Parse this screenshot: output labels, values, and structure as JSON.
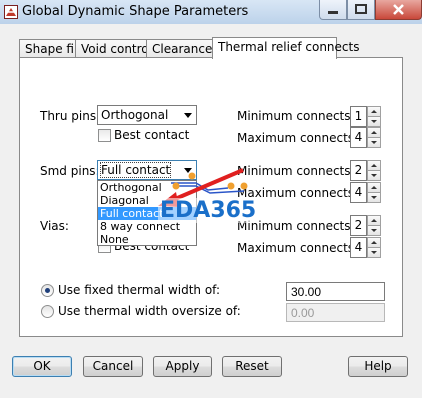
{
  "window": {
    "title": "Global Dynamic Shape Parameters"
  },
  "tabs": [
    "Shape fill",
    "Void controls",
    "Clearances",
    "Thermal relief connects"
  ],
  "thru_pins": {
    "label": "Thru pins:",
    "value": "Orthogonal",
    "best_contact_label": "Best contact",
    "min_label": "Minimum connects",
    "min_value": "1",
    "max_label": "Maximum connects",
    "max_value": "4"
  },
  "smd_pins": {
    "label": "Smd pins:",
    "value": "Full contact",
    "min_label": "Minimum connects",
    "min_value": "2",
    "max_label": "Maximum connects",
    "max_value": "4",
    "options": [
      "Orthogonal",
      "Diagonal",
      "Full contact",
      "8 way connect",
      "None"
    ],
    "selected_option": "Full contact"
  },
  "vias": {
    "label": "Vias:",
    "best_contact_label": "Best contact",
    "min_label": "Minimum connects",
    "min_value": "2",
    "max_label": "Maximum connects",
    "max_value": "4"
  },
  "thermal_width": {
    "fixed_label": "Use fixed thermal width of:",
    "fixed_value": "30.00",
    "fixed_selected": true,
    "oversize_label": "Use thermal width oversize of:",
    "oversize_value": "0.00"
  },
  "buttons": {
    "ok": "OK",
    "cancel": "Cancel",
    "apply": "Apply",
    "reset": "Reset",
    "help": "Help"
  },
  "watermark": "EDA365",
  "colors": {
    "accent": "#3399ff",
    "annotation": "#e02020",
    "annotation_dot": "#f0a030",
    "watermark": "#1a6fc9"
  }
}
